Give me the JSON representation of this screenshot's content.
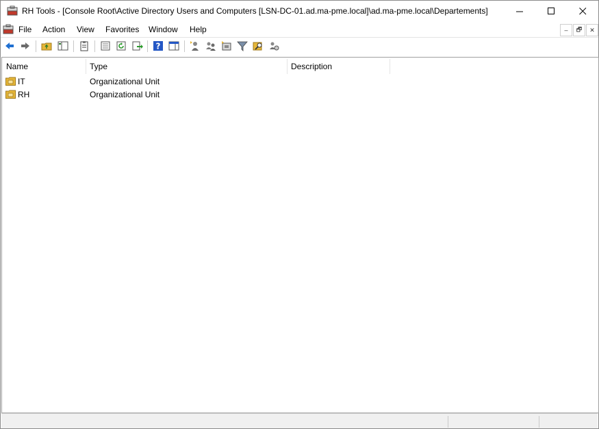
{
  "window": {
    "title": "RH Tools - [Console Root\\Active Directory Users and Computers [LSN-DC-01.ad.ma-pme.local]\\ad.ma-pme.local\\Departements]",
    "controls": {
      "minimize": "–",
      "maximize": "□",
      "close": "✕"
    }
  },
  "menu": {
    "items": [
      "File",
      "Action",
      "View",
      "Favorites",
      "Window",
      "Help"
    ],
    "mdi_controls": {
      "minimize": "–",
      "restore": "🗗",
      "close": "✕"
    }
  },
  "toolbar": {
    "icons": [
      "back-arrow-icon",
      "forward-arrow-icon",
      "up-folder-icon",
      "show-hide-tree-icon",
      "clipboard-icon",
      "properties-icon",
      "refresh-icon",
      "export-list-icon",
      "help-icon",
      "action-pane-icon",
      "new-user-icon",
      "new-group-icon",
      "new-ou-icon",
      "filter-icon",
      "find-icon",
      "delegate-icon"
    ]
  },
  "list": {
    "columns": [
      "Name",
      "Type",
      "Description"
    ],
    "rows": [
      {
        "name": "IT",
        "type": "Organizational Unit",
        "description": ""
      },
      {
        "name": "RH",
        "type": "Organizational Unit",
        "description": ""
      }
    ]
  },
  "colors": {
    "accent_blue": "#1f6fd1",
    "ou_yellow": "#e6b73a",
    "border": "#a0a0a0"
  }
}
